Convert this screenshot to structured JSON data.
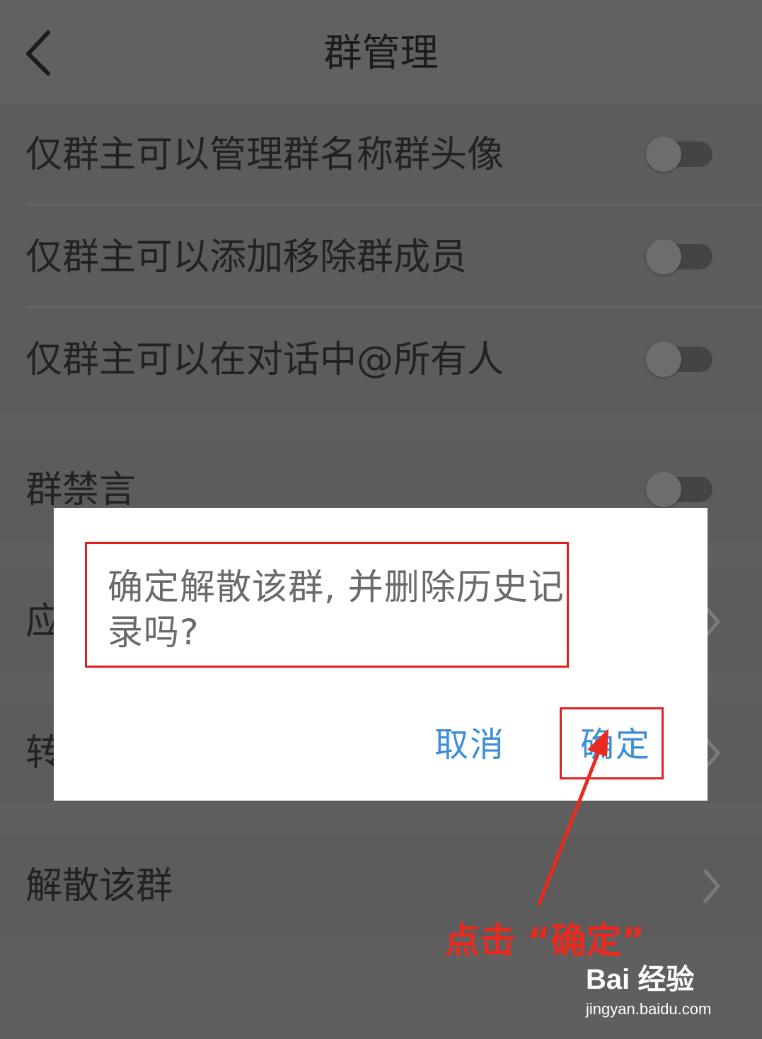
{
  "header": {
    "title": "群管理"
  },
  "settings": [
    {
      "label": "仅群主可以管理群名称群头像",
      "control": "toggle",
      "on": false
    },
    {
      "label": "仅群主可以添加移除群成员",
      "control": "toggle",
      "on": false
    },
    {
      "label": "仅群主可以在对话中@所有人",
      "control": "toggle",
      "on": false
    },
    {
      "label": "群禁言",
      "control": "toggle",
      "on": false
    },
    {
      "label": "应",
      "control": "chevron"
    },
    {
      "label": "转",
      "control": "chevron"
    },
    {
      "label": "解散该群",
      "control": "chevron"
    }
  ],
  "dialog": {
    "message": "确定解散该群, 并删除历史记录吗?",
    "cancel_label": "取消",
    "confirm_label": "确定"
  },
  "annotation": {
    "text": "点击 “确定”",
    "color": "#e82a1f"
  },
  "watermark": {
    "brand": "Bai 经验",
    "url": "jingyan.baidu.com"
  },
  "colors": {
    "accent": "#3d8ed8",
    "highlight": "#e02020",
    "overlay": "#5f5f5f"
  }
}
